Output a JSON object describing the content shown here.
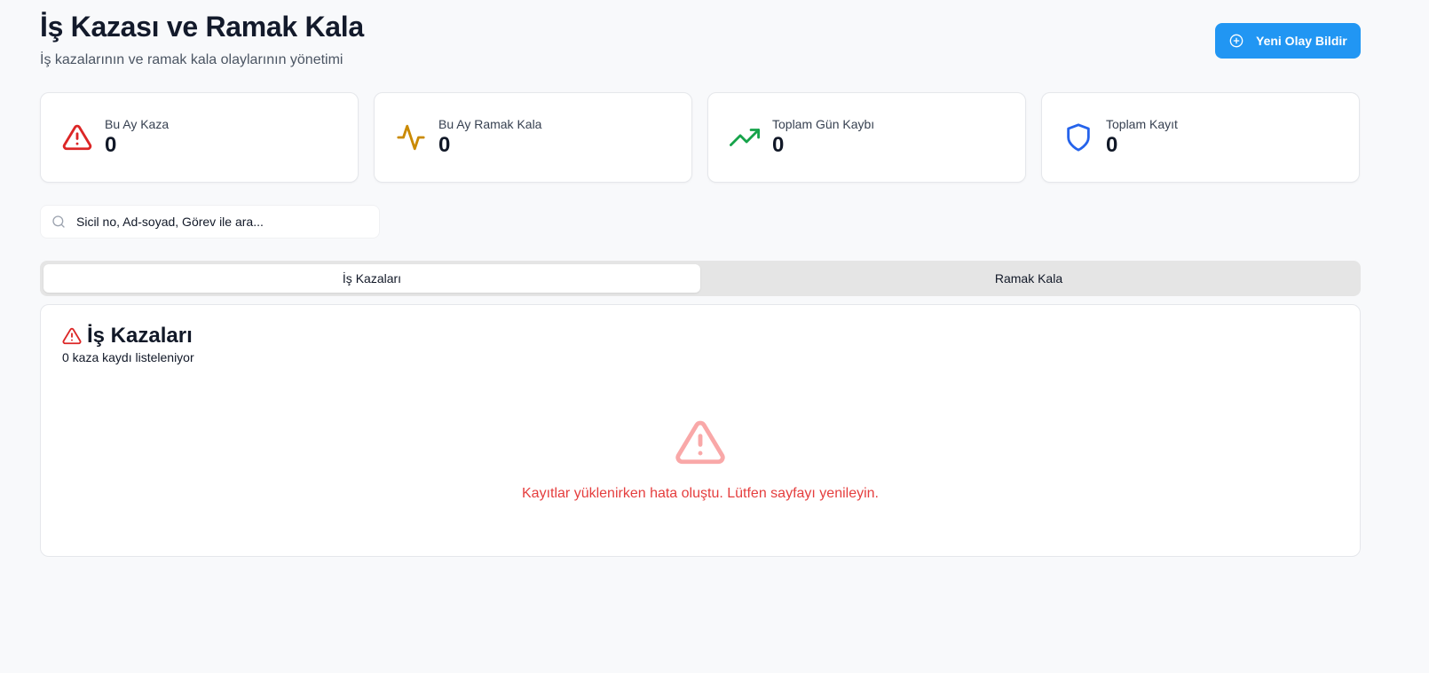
{
  "header": {
    "title": "İş Kazası ve Ramak Kala",
    "subtitle": "İş kazalarının ve ramak kala olaylarının yönetimi",
    "new_button_label": "Yeni Olay Bildir",
    "new_button_icon": "plus-circle-icon"
  },
  "stats": [
    {
      "label": "Bu Ay Kaza",
      "value": "0",
      "icon": "alert-triangle-icon",
      "color": "#dc2626"
    },
    {
      "label": "Bu Ay Ramak Kala",
      "value": "0",
      "icon": "activity-icon",
      "color": "#ca8a04"
    },
    {
      "label": "Toplam Gün Kaybı",
      "value": "0",
      "icon": "trending-up-icon",
      "color": "#16a34a"
    },
    {
      "label": "Toplam Kayıt",
      "value": "0",
      "icon": "shield-icon",
      "color": "#2563eb"
    }
  ],
  "search": {
    "placeholder": "Sicil no, Ad-soyad, Görev ile ara..."
  },
  "tabs": [
    {
      "label": "İş Kazaları",
      "active": true
    },
    {
      "label": "Ramak Kala",
      "active": false
    }
  ],
  "panel": {
    "title": "İş Kazaları",
    "subtitle": "0 kaza kaydı listeleniyor",
    "error_message": "Kayıtlar yüklenirken hata oluştu. Lütfen sayfayı yenileyin."
  },
  "colors": {
    "accent": "#2196f3",
    "error": "#e53e3e",
    "error_icon": "#f9a8a8"
  }
}
